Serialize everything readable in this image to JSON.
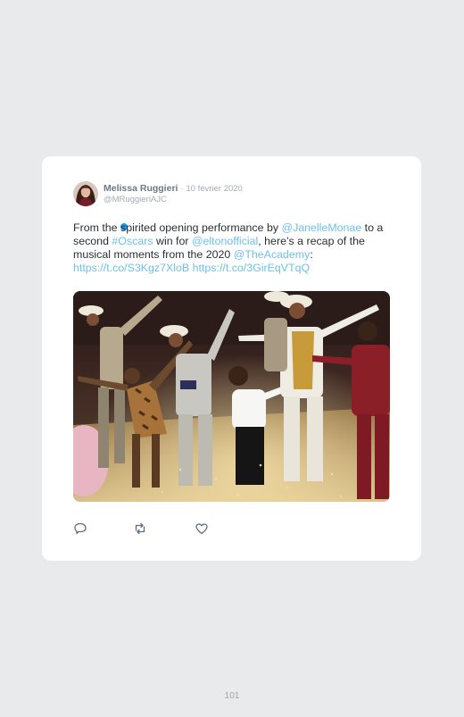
{
  "tweet": {
    "author_name": "Melissa Ruggieri",
    "separator": "·",
    "date": "10 février 2020",
    "handle": "@MRuggieriAJC",
    "text_parts": {
      "p1": "From the spirited opening performance by ",
      "p2": "@JanelleMonae",
      "p3": " to a second ",
      "p4": "#Oscars",
      "p5": " win for ",
      "p6": "@eltonofficial",
      "p7": ", here’s a recap of the musical moments from the 2020 ",
      "p8": "@TheAcademy",
      "p9": ": ",
      "p10": "https://t.co/S3Kgz7XloB",
      "p11": " ",
      "p12": "https://t.co/3GirEqVTqQ"
    },
    "link_color": "#6ec0ea",
    "media_description_icon": "photo"
  },
  "actions": {
    "reply_icon": "reply-icon",
    "retweet_icon": "retweet-icon",
    "like_icon": "heart-icon"
  },
  "footer": {
    "page_number": "101"
  }
}
